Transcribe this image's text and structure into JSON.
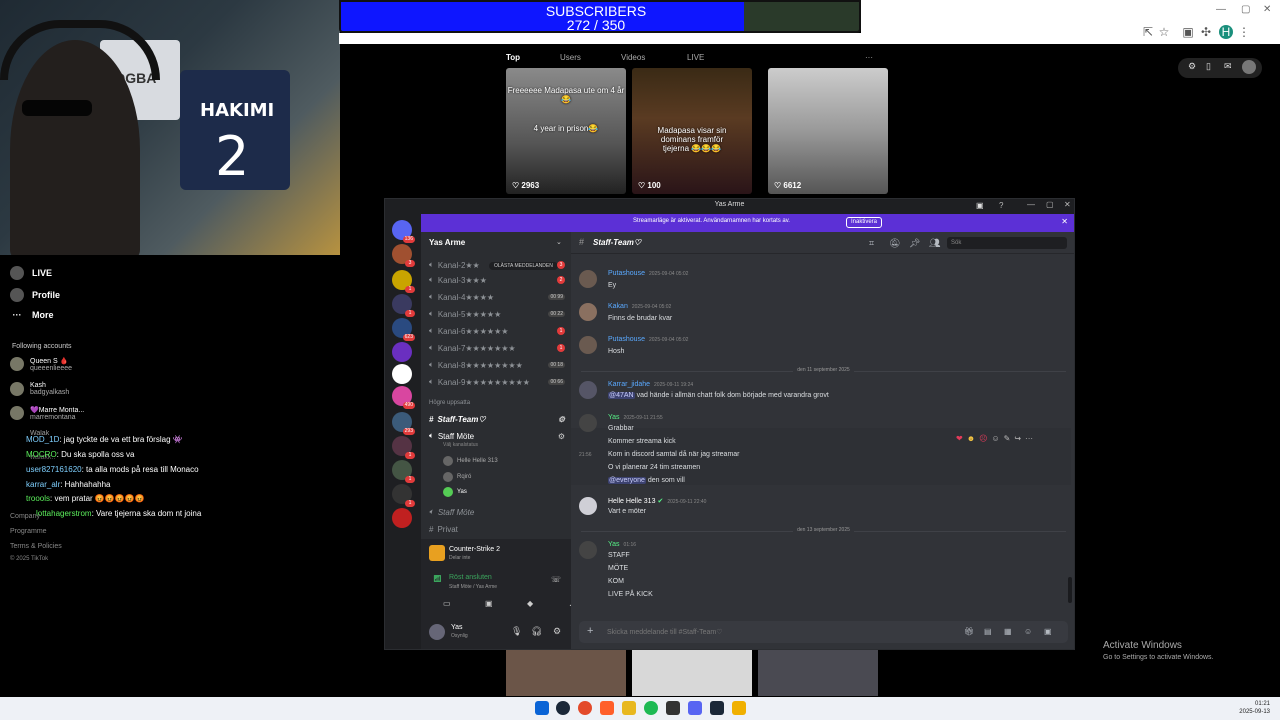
{
  "subscribers": {
    "title": "SUBSCRIBERS",
    "count_text": "272 / 350",
    "current": 272,
    "goal": 350
  },
  "webcam": {
    "jersey_name": "HAKIMI",
    "jersey_number": "2",
    "shirt2_name": "POGBA"
  },
  "tiktok": {
    "nav": [
      {
        "label": "LIVE"
      },
      {
        "label": "Profile"
      },
      {
        "label": "More"
      }
    ],
    "following_header": "Following accounts",
    "following": [
      {
        "name": "Queen S 🩸",
        "handle": "queeenlieeee"
      },
      {
        "name": "Kash",
        "handle": "badgyalkash"
      },
      {
        "name": "💜Marre Monta...",
        "handle": "marremontana"
      },
      {
        "name": "Walak",
        "handle": "walakk.."
      }
    ],
    "chat": [
      {
        "user": "MOD_1D",
        "text": ": jag tyckte de va ett bra förslag 👾"
      },
      {
        "user": "MOCRO",
        "text": ": Du ska spolla oss va"
      },
      {
        "user": "user827161620",
        "text": ": ta alla mods på resa till Monaco"
      },
      {
        "user": "karrar_alr",
        "text": ": Hahhahahha"
      },
      {
        "user": "troools",
        "text": ": vem pratar 😡😡😡😡😡"
      },
      {
        "user": "lottahagerstrom",
        "text": ": Vare tjejerna ska dom nt joina"
      }
    ],
    "footer": [
      "Company",
      "Programme",
      "Terms & Policies",
      "© 2025 TikTok"
    ],
    "tabs": [
      "Top",
      "Users",
      "Videos",
      "LIVE"
    ],
    "more_icon": "···",
    "videos": [
      {
        "caption1": "Freeeeee Madapasa ute om 4 år😂",
        "caption2": "4 year in prison😂",
        "likes": "2963"
      },
      {
        "caption1": "Madapasa visar sin dominans framför tjejerna 😂😂😂",
        "caption2": "",
        "likes": "100"
      },
      {
        "caption1": "",
        "caption2": "",
        "likes": "6612"
      }
    ]
  },
  "discord": {
    "window_title": "Yas Arme",
    "banner_text": "Streamarläge är aktiverat. Användarnamnen har kortats av.",
    "banner_button": "Inaktivera",
    "server_name": "Yas Arme",
    "unread_pill": "OLÄSTA MEDDELANDEN",
    "channels": [
      {
        "name": "Kanal-2★★",
        "counts": "",
        "red": "3"
      },
      {
        "name": "Kanal-3★★★",
        "counts": "",
        "red": "2"
      },
      {
        "name": "Kanal-4★★★★",
        "counts": "00 99",
        "red": ""
      },
      {
        "name": "Kanal-5★★★★★",
        "counts": "00 22",
        "red": ""
      },
      {
        "name": "Kanal-6★★★★★★",
        "counts": "",
        "red": "1"
      },
      {
        "name": "Kanal-7★★★★★★★",
        "counts": "",
        "red": "1"
      },
      {
        "name": "Kanal-8★★★★★★★★",
        "counts": "00 18",
        "red": ""
      },
      {
        "name": "Kanal-9★★★★★★★★★",
        "counts": "00 66",
        "red": ""
      }
    ],
    "category": "Högre uppsatta",
    "staff_team": "Staff-Team♡",
    "staff_mote": "Staff Möte",
    "staff_mote_status": "Välj kanalstatus",
    "voice_users": [
      "Helle Helle 313",
      "Rqiró",
      "Yas"
    ],
    "staff_mote2": "Staff Möte",
    "privat": "Privat",
    "activity_game": "Counter-Strike 2",
    "activity_sub": "Delar inte",
    "voice_connected": "Röst ansluten",
    "voice_location": "Staff Möte / Yas Arme",
    "user_name": "Yas",
    "user_status": "Osynlig",
    "channel_header": "Staff-Team♡",
    "search_placeholder": "Sök",
    "messages": [
      {
        "name": "Putashouse",
        "time": "2025-09-04 05:02",
        "lines": [
          "Ey"
        ]
      },
      {
        "name": "Kakan",
        "time": "2025-09-04 05:02",
        "lines": [
          "Finns de brudar kvar"
        ]
      },
      {
        "name": "Putashouse",
        "time": "2025-09-04 05:02",
        "lines": [
          "Hosh"
        ]
      },
      {
        "name": "Karrar_jidahe",
        "time": "2025-09-11 19:24",
        "mention": "@47AN",
        "lines": [
          "vad hände i allmän chatt folk dom började med varandra grovt"
        ]
      },
      {
        "name": "Yas",
        "time": "2025-09-11 21:55",
        "lines": [
          "Grabbar",
          "Kommer streama kick",
          "Kom in discord samtal då när jag streamar",
          "O vi planerar 24 tim streamen"
        ],
        "mention": "@everyone",
        "mention_tail": "den som vill",
        "side_time": "21:56"
      },
      {
        "name": "Helle Helle 313",
        "time": "2025-09-11 22:40",
        "lines": [
          "Vart e möter"
        ]
      },
      {
        "name": "Yas",
        "time": "01:16",
        "lines": [
          "STAFF",
          "MÖTE",
          "KOM",
          "LIVE PÅ KICK"
        ]
      }
    ],
    "date_sep1": "den 11 september 2025",
    "date_sep2": "den 13 september 2025",
    "input_placeholder": "Skicka meddelande till #Staff-Team♡"
  },
  "activate_windows": {
    "title": "Activate Windows",
    "sub": "Go to Settings to activate Windows."
  },
  "taskbar": {
    "time": "01:21",
    "date": "2025-09-13"
  },
  "colors": {
    "discord_bg": "#313338",
    "banner": "#5c30d6",
    "subs_fill": "#0e16ff"
  }
}
